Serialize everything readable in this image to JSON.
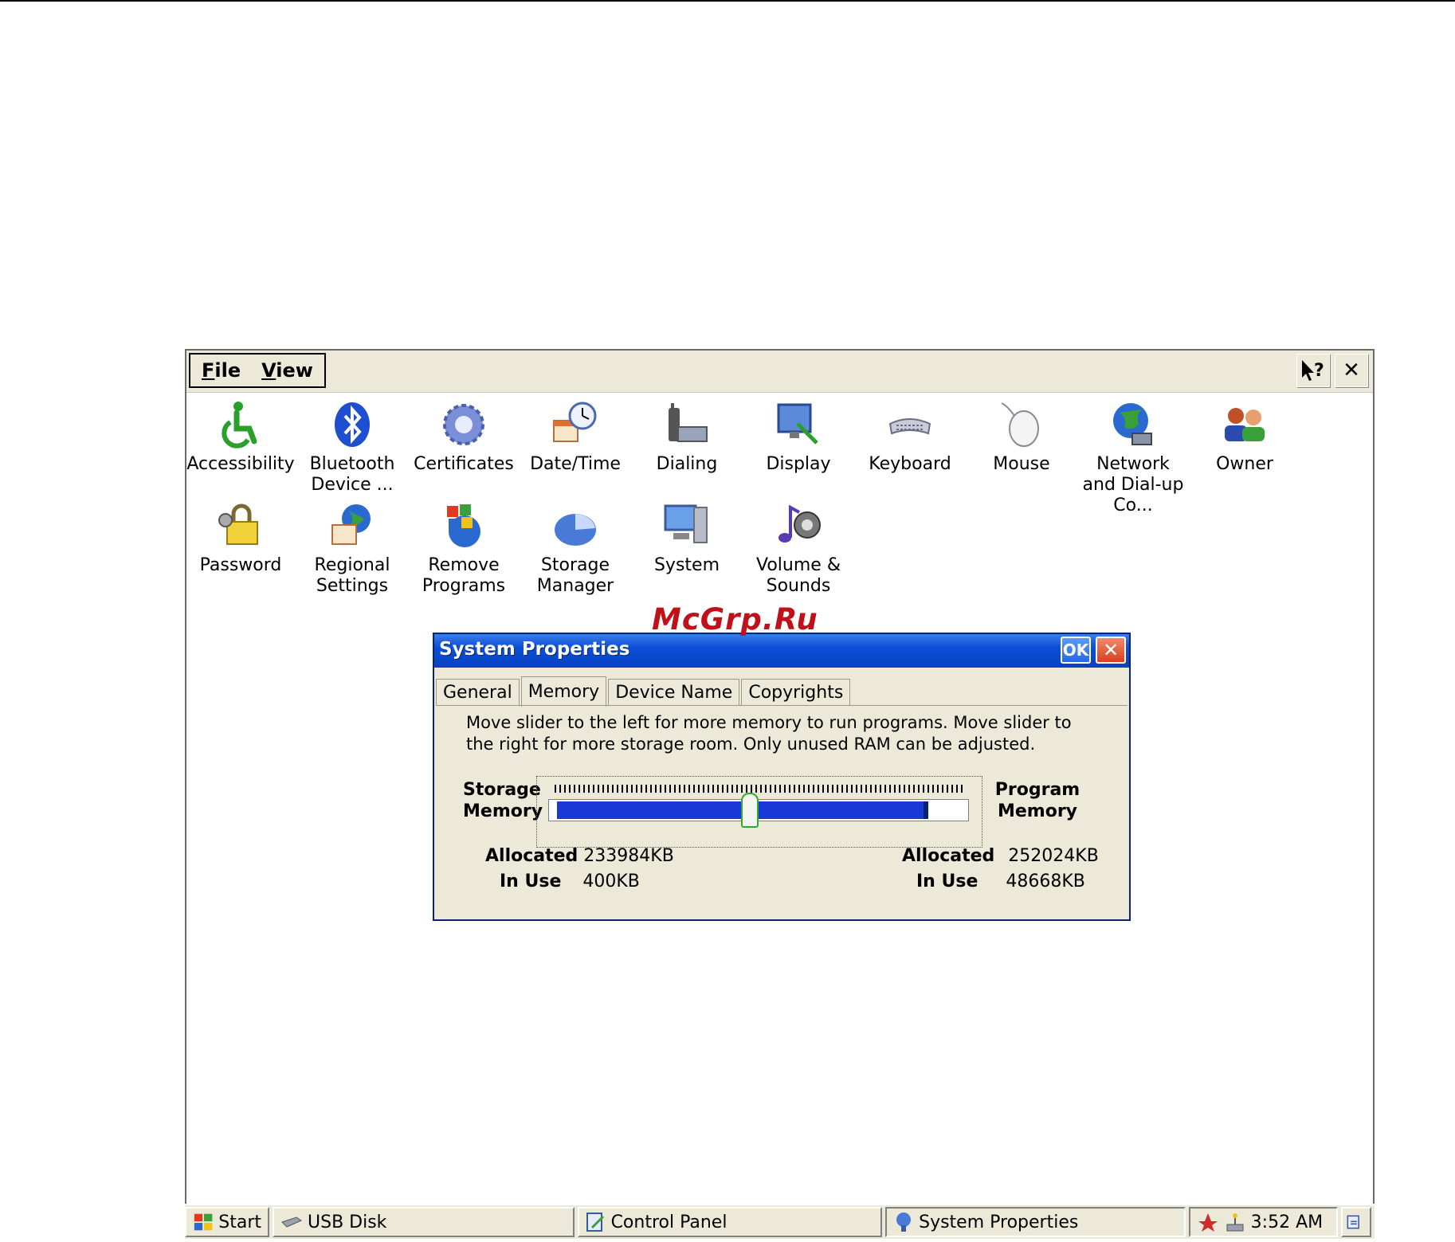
{
  "menu": {
    "file": "File",
    "view": "View"
  },
  "titlebar": {
    "help": "?",
    "close": "✕"
  },
  "control_panel": {
    "items": [
      {
        "label": "Accessibility",
        "icon": "accessibility-icon"
      },
      {
        "label": "Bluetooth Device ...",
        "icon": "bluetooth-icon"
      },
      {
        "label": "Certificates",
        "icon": "certificates-icon"
      },
      {
        "label": "Date/Time",
        "icon": "datetime-icon"
      },
      {
        "label": "Dialing",
        "icon": "dialing-icon"
      },
      {
        "label": "Display",
        "icon": "display-icon"
      },
      {
        "label": "Keyboard",
        "icon": "keyboard-icon"
      },
      {
        "label": "Mouse",
        "icon": "mouse-icon"
      },
      {
        "label": "Network and Dial-up Co...",
        "icon": "network-icon"
      },
      {
        "label": "Owner",
        "icon": "owner-icon"
      },
      {
        "label": "Password",
        "icon": "password-icon"
      },
      {
        "label": "Regional Settings",
        "icon": "regional-icon"
      },
      {
        "label": "Remove Programs",
        "icon": "remove-programs-icon"
      },
      {
        "label": "Storage Manager",
        "icon": "storage-manager-icon"
      },
      {
        "label": "System",
        "icon": "system-icon"
      },
      {
        "label": "Volume & Sounds",
        "icon": "volume-icon"
      }
    ]
  },
  "watermark": "McGrp.Ru",
  "dialog": {
    "title": "System Properties",
    "ok": "OK",
    "close": "✕",
    "tabs": [
      "General",
      "Memory",
      "Device Name",
      "Copyrights"
    ],
    "active_tab": "Memory",
    "description": "Move slider to the left for more memory to run programs. Move slider to the right for more storage room. Only unused RAM can be adjusted.",
    "storage_label": "Storage Memory",
    "program_label": "Program Memory",
    "slider_position": 0.48,
    "storage": {
      "allocated_label": "Allocated",
      "allocated": "233984KB",
      "inuse_label": "In Use",
      "inuse": "400KB"
    },
    "program": {
      "allocated_label": "Allocated",
      "allocated": "252024KB",
      "inuse_label": "In Use",
      "inuse": "48668KB"
    }
  },
  "taskbar": {
    "start": "Start",
    "items": [
      "USB Disk",
      "Control Panel",
      "System Properties"
    ],
    "clock": "3:52 AM"
  },
  "colors": {
    "titlebar": "#0a4fd8",
    "slider_fill": "#1838d8",
    "watermark": "#c0101a"
  }
}
